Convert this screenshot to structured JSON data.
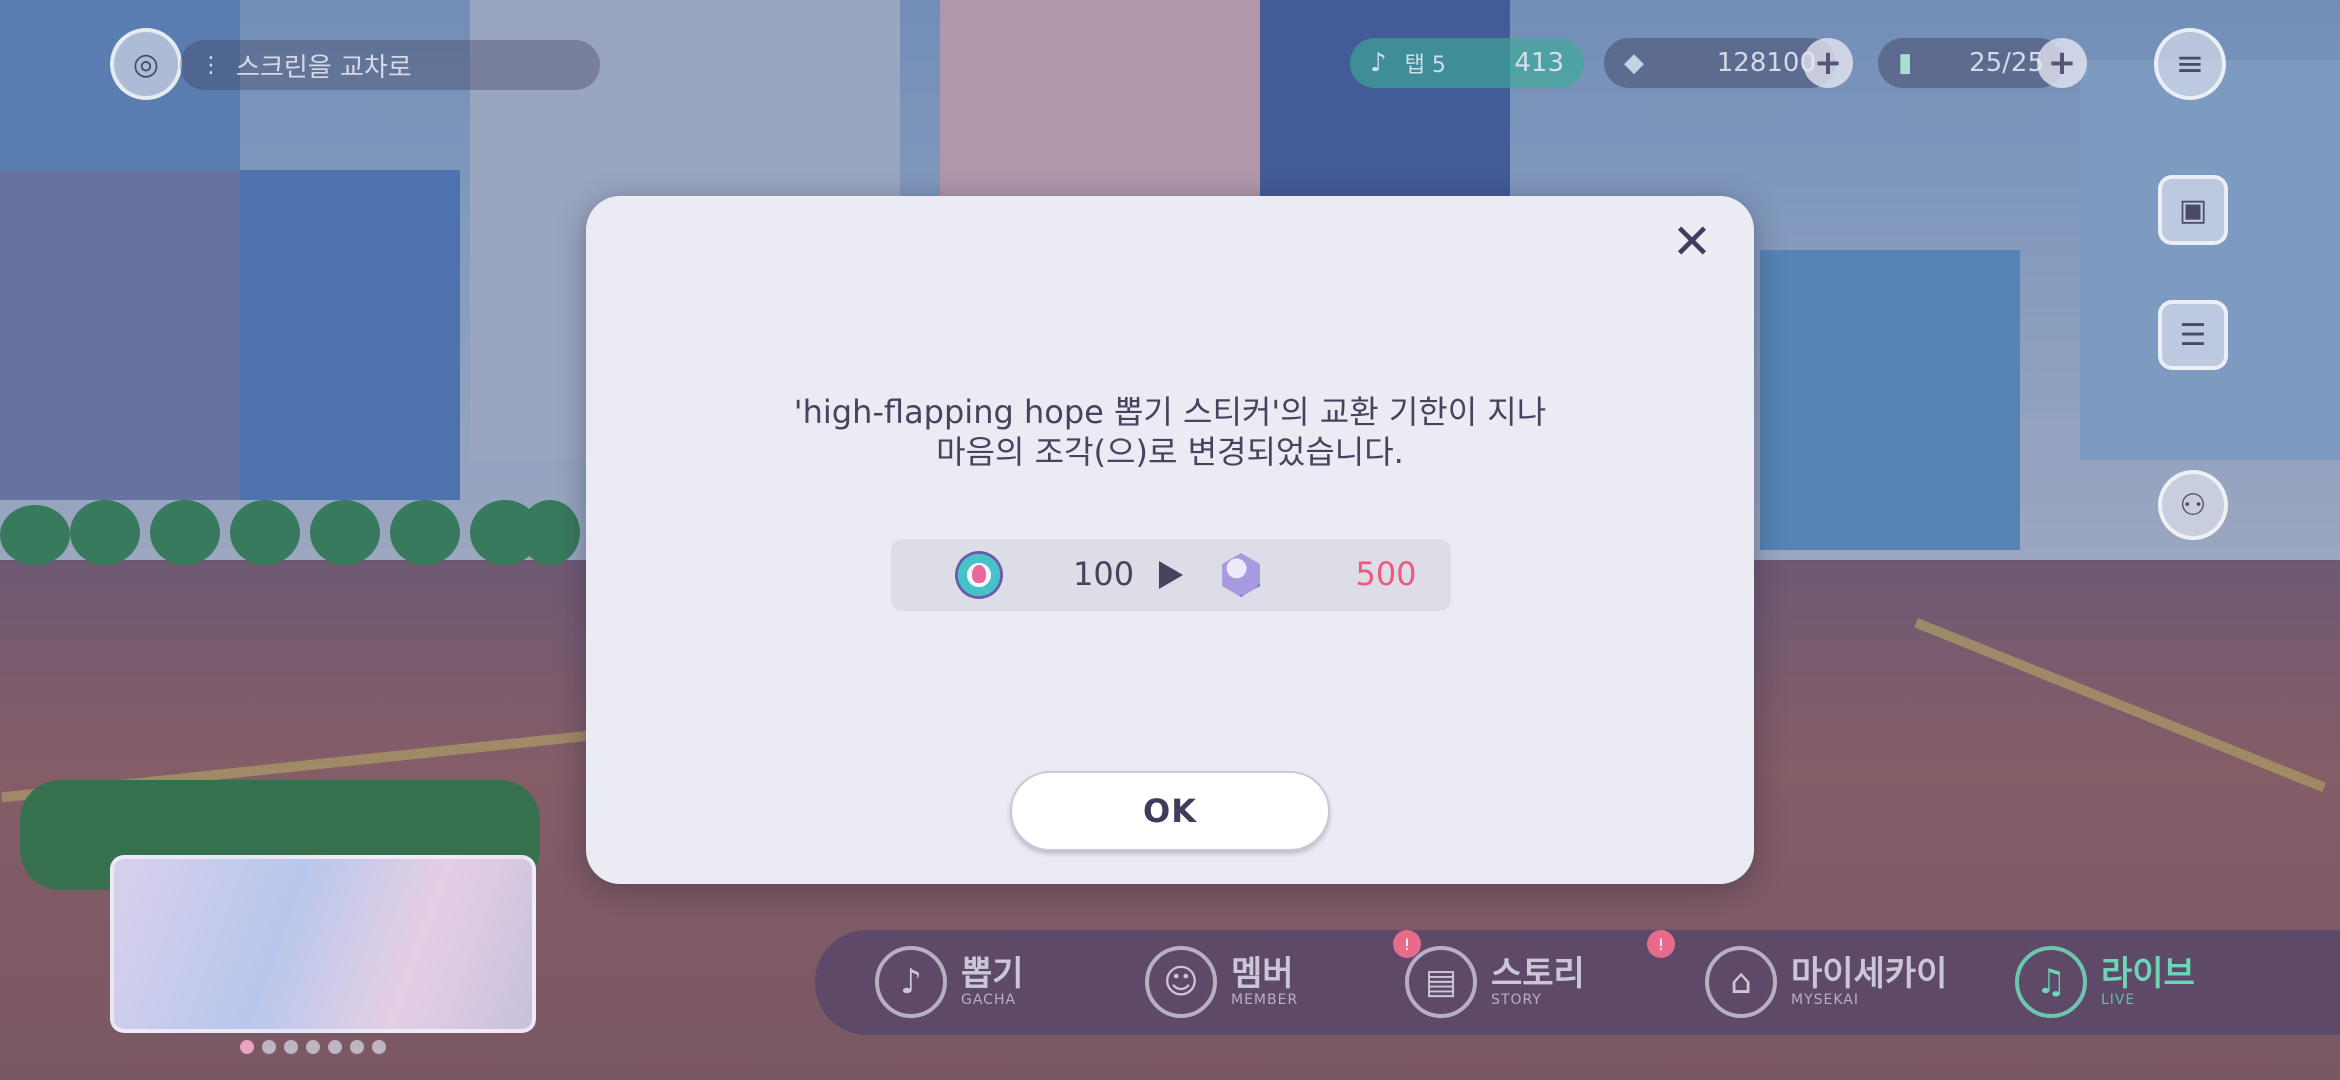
{
  "hud": {
    "left_icon": "globe-icon",
    "left_label": "스크린을 교차로",
    "event_label": "탭 5",
    "event_value": "413",
    "currency_1_value": "128100",
    "currency_2_value": "25/25",
    "menu_icon": "hamburger-menu-icon"
  },
  "dialog": {
    "message_line1": "'high-flapping hope 뽑기 스티커'의 교환 기한이 지나",
    "message_line2": "마음의 조각(으)로 변경되었습니다.",
    "from_icon": "sticker-coin-icon",
    "from_value": "100",
    "arrow_icon": "play-arrow-icon",
    "to_icon": "heart-fragment-gem-icon",
    "to_value": "500",
    "ok_label": "OK",
    "close_icon": "close-icon",
    "to_value_color": "#f2587f"
  },
  "bottom_nav": {
    "items": [
      {
        "label": "뽑기",
        "sub": "GACHA",
        "icon": "gacha-icon"
      },
      {
        "label": "멤버",
        "sub": "MEMBER",
        "icon": "member-icon"
      },
      {
        "label": "스토리",
        "sub": "STORY",
        "icon": "story-book-icon",
        "badge": "!"
      },
      {
        "label": "마이세카이",
        "sub": "MYSEKAI",
        "icon": "house-icon",
        "badge": "!"
      },
      {
        "label": "라이브",
        "sub": "LIVE",
        "icon": "music-note-icon"
      }
    ]
  }
}
